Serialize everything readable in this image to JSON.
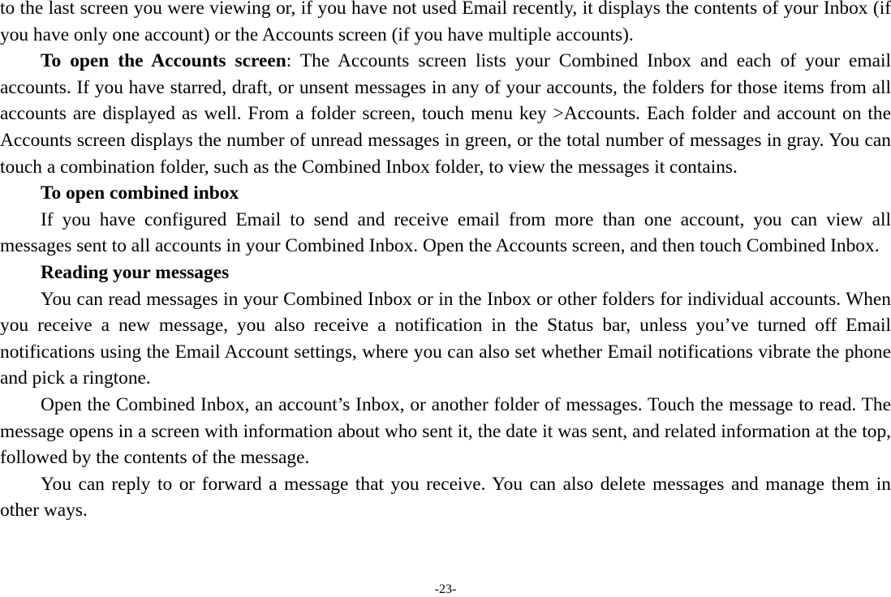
{
  "paragraphs": [
    {
      "id": "intro-continued",
      "heading": "",
      "text": "to the last screen you were viewing or, if you have not used Email recently, it displays the contents of your Inbox (if you have only one account) or the Accounts screen (if you have multiple accounts)."
    },
    {
      "id": "open-accounts",
      "heading": "To open the Accounts screen",
      "text": ": The Accounts screen lists your Combined Inbox and each of your email accounts. If you have starred, draft, or unsent messages in any of your accounts, the folders for those items from all accounts are displayed as well. From a folder screen, touch menu key >Accounts. Each folder and account on the Accounts screen displays the number of unread messages in green, or the total number of messages in gray. You can touch a combination folder, such as the Combined Inbox folder, to view the messages it contains."
    },
    {
      "id": "combined-inbox-heading",
      "heading": "To open combined inbox",
      "text": ""
    },
    {
      "id": "combined-inbox-body",
      "heading": "",
      "text": "If you have configured Email to send and receive email from more than one account, you can view all messages sent to all accounts in your Combined Inbox. Open the Accounts screen, and then touch Combined Inbox."
    },
    {
      "id": "reading-heading",
      "heading": "Reading your messages",
      "text": ""
    },
    {
      "id": "reading-body-1",
      "heading": "",
      "text": "You can read messages in your Combined Inbox or in the Inbox or other folders for individual accounts. When you receive a new message, you also receive a notification in the Status bar, unless you’ve turned off Email notifications using the Email Account settings, where you can also set whether Email notifications vibrate the phone and pick a ringtone."
    },
    {
      "id": "reading-body-2",
      "heading": "",
      "text": "Open the Combined Inbox, an account’s Inbox, or another folder of messages. Touch the message to read. The message opens in a screen with information about who sent it, the date it was sent, and related information at the top, followed by the contents of the message."
    },
    {
      "id": "reading-body-3",
      "heading": "",
      "text": "You can reply to or forward a message that you receive. You can also delete messages and manage them in other ways."
    }
  ],
  "footer": {
    "page_number": "-23-"
  }
}
